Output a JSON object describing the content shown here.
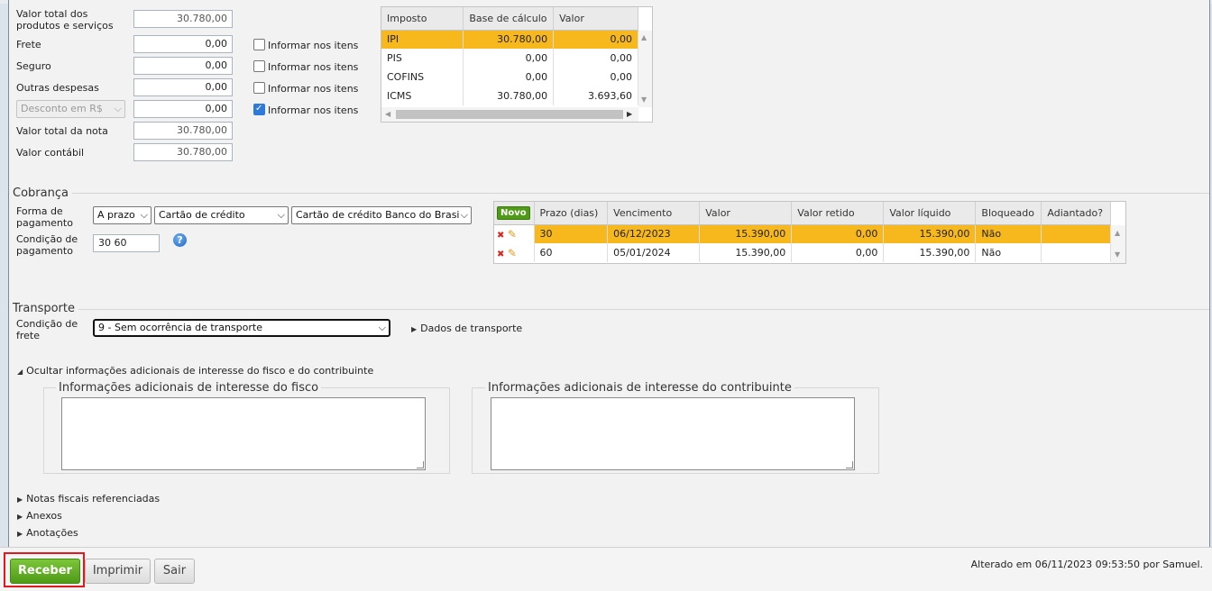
{
  "totals": {
    "valor_total_produtos_label": "Valor total dos produtos e serviços",
    "valor_total_produtos": "30.780,00",
    "frete_label": "Frete",
    "frete": "0,00",
    "seguro_label": "Seguro",
    "seguro": "0,00",
    "outras_label": "Outras despesas",
    "outras": "0,00",
    "desconto_select": "Desconto em R$",
    "desconto": "0,00",
    "valor_nota_label": "Valor total da nota",
    "valor_nota": "30.780,00",
    "valor_contabil_label": "Valor contábil",
    "valor_contabil": "30.780,00",
    "informar_label": "Informar nos itens",
    "informar_checked": [
      false,
      false,
      false,
      true
    ]
  },
  "impostos": {
    "headers": [
      "Imposto",
      "Base de cálculo",
      "Valor"
    ],
    "rows": [
      {
        "imposto": "IPI",
        "base": "30.780,00",
        "valor": "0,00"
      },
      {
        "imposto": "PIS",
        "base": "0,00",
        "valor": "0,00"
      },
      {
        "imposto": "COFINS",
        "base": "0,00",
        "valor": "0,00"
      },
      {
        "imposto": "ICMS",
        "base": "30.780,00",
        "valor": "3.693,60"
      }
    ]
  },
  "cobranca": {
    "title": "Cobrança",
    "forma_label": "Forma de pagamento",
    "forma_prazo": "A prazo",
    "forma_tipo": "Cartão de crédito",
    "forma_conta": "Cartão de crédito Banco do Brasil",
    "condicao_label": "Condição de pagamento",
    "condicao": "30 60",
    "help": "?",
    "novo": "Novo",
    "headers": [
      "Prazo (dias)",
      "Vencimento",
      "Valor",
      "Valor retido",
      "Valor líquido",
      "Bloqueado",
      "Adiantado?"
    ],
    "rows": [
      {
        "prazo": "30",
        "vencimento": "06/12/2023",
        "valor": "15.390,00",
        "retido": "0,00",
        "liquido": "15.390,00",
        "bloqueado": "Não",
        "adiantado": ""
      },
      {
        "prazo": "60",
        "vencimento": "05/01/2024",
        "valor": "15.390,00",
        "retido": "0,00",
        "liquido": "15.390,00",
        "bloqueado": "Não",
        "adiantado": ""
      }
    ]
  },
  "transporte": {
    "title": "Transporte",
    "condicao_label": "Condição de frete",
    "condicao": "9 - Sem ocorrência de transporte",
    "dados_link": "Dados de transporte"
  },
  "adicionais": {
    "toggle": "Ocultar informações adicionais de interesse do fisco e do contribuinte",
    "fisco_label": "Informações adicionais de interesse do fisco",
    "contribuinte_label": "Informações adicionais de interesse do contribuinte"
  },
  "expanders": {
    "notas": "Notas fiscais referenciadas",
    "anexos": "Anexos",
    "anotacoes": "Anotações"
  },
  "footer": {
    "receber": "Receber",
    "imprimir": "Imprimir",
    "sair": "Sair",
    "status": "Alterado em 06/11/2023 09:53:50 por Samuel."
  },
  "colors": {
    "selected_row": "#f6b81d",
    "primary_button": "#4f9a17",
    "highlight_box": "#e0191e"
  }
}
